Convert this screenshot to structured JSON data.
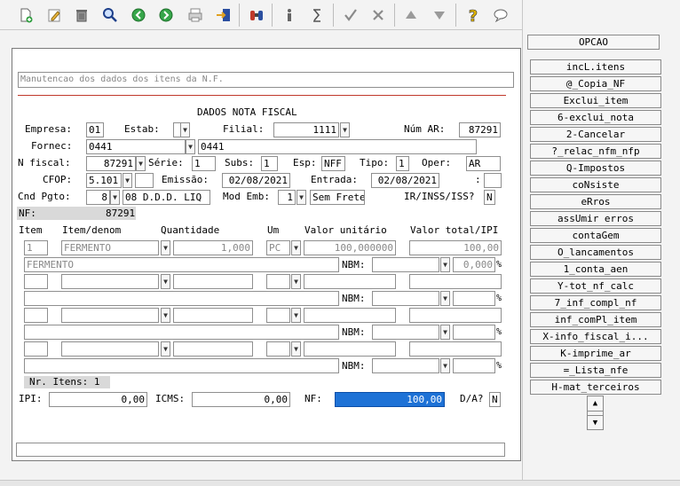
{
  "toolbar": {
    "icons": [
      "new-doc-icon",
      "edit-icon",
      "trash-icon",
      "search-icon",
      "back-icon",
      "forward-icon",
      "print-icon",
      "export-icon",
      "binoculars-icon",
      "info-icon",
      "sigma-icon",
      "check-icon",
      "cancel-icon",
      "up-icon",
      "down-icon",
      "help-icon",
      "chat-icon"
    ]
  },
  "header": {
    "description": "Manutencao dos dados dos itens da N.F.",
    "section_title": "DADOS NOTA FISCAL"
  },
  "labels": {
    "empresa": "Empresa:",
    "estab": "Estab:",
    "filial": "Filial:",
    "num_ar": "Núm AR:",
    "fornec": "Fornec:",
    "nfiscal": "N fiscal:",
    "serie": "Série:",
    "subs": "Subs:",
    "esp": "Esp:",
    "tipo": "Tipo:",
    "oper": "Oper:",
    "cfop": "CFOP:",
    "emissao": "Emissão:",
    "entrada": "Entrada:",
    "colon": ":",
    "cnd_pgto": "Cnd Pgto:",
    "mod_emb": "Mod Emb:",
    "ir": "IR/INSS/ISS?",
    "nf": "NF:",
    "item": "Item",
    "item_denom": "Item/denom",
    "quantidade": "Quantidade",
    "um": "Um",
    "valor_unitario": "Valor unitário",
    "valor_total": "Valor total/IPI",
    "nbm": "NBM:",
    "nr_itens": "Nr. Itens: 1",
    "ipi": "IPI:",
    "icms": "ICMS:",
    "nf2": "NF:",
    "da": "D/A?",
    "pct": "%"
  },
  "values": {
    "empresa": "01",
    "estab": "",
    "filial": "1111",
    "num_ar": "87291",
    "fornec_code": "0441",
    "fornec_name": "0441",
    "nfiscal": "87291",
    "serie": "1",
    "subs": "1",
    "esp": "NFF",
    "tipo": "1",
    "oper": "AR",
    "cfop": "5.101",
    "cfop2": "",
    "emissao": "02/08/2021",
    "entrada": "02/08/2021",
    "extra": "",
    "cnd_pgto": "8",
    "cnd_pgto_desc": "08 D.D.D. LIQ",
    "mod_emb": "1",
    "mod_emb_desc": "Sem Frete",
    "ir": "N",
    "nf_number": "87291",
    "ipi": "0,00",
    "icms": "0,00",
    "nf_total": "100,00",
    "da": "N"
  },
  "item_row": {
    "item": "1",
    "denom": "FERMENTO",
    "quantidade": "1,000",
    "um": "PC",
    "valor_unitario": "100,000000",
    "valor_total": "100,00",
    "description": "FERMENTO",
    "ipi_pct": "0,000"
  },
  "buttons": {
    "opcao": "OPCAO",
    "list": [
      "incL.itens",
      "@_Copia_NF",
      "Exclui_item",
      "6-exclui_nota",
      "2-Cancelar",
      "?_relac_nfm_nfp",
      "Q-Impostos",
      "coNsiste",
      "eRros",
      "assUmir erros",
      "contaGem",
      "O_lancamentos",
      "1_conta_aen",
      "Y-tot_nf_calc",
      "7_inf_compl_nf",
      "inf_comPl_item",
      "X-info_fiscal_i...",
      "K-imprime_ar",
      "=_Lista_nfe",
      "H-mat_terceiros"
    ]
  },
  "colors": {
    "accent": "#1e72d6",
    "separator": "#c0392b",
    "gray_band": "#d9d9d9"
  }
}
